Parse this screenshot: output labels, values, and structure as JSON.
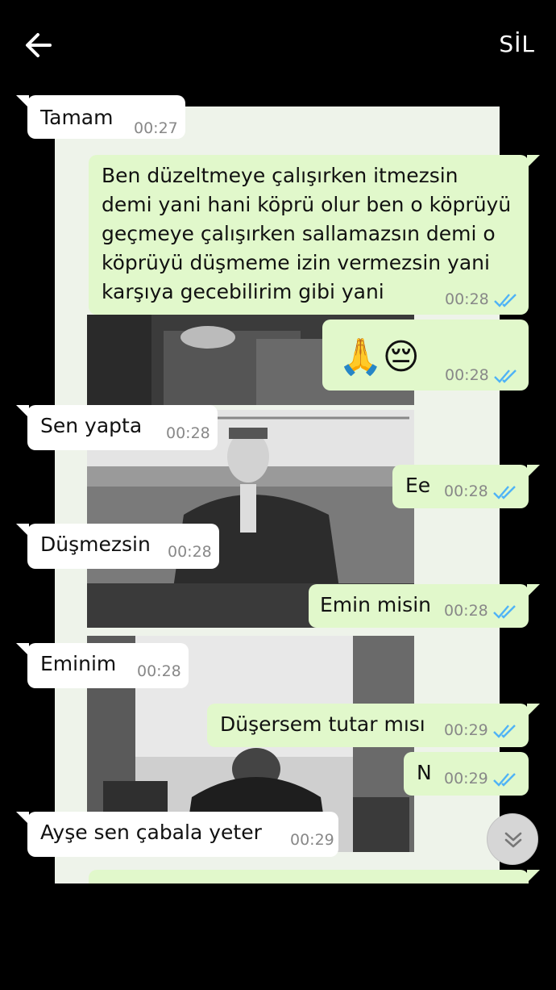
{
  "header": {
    "back_icon": "arrow-left-icon",
    "delete_label": "SİL"
  },
  "messages": [
    {
      "dir": "in",
      "text": "Tamam",
      "time": "00:27"
    },
    {
      "dir": "out",
      "lines": [
        "Ben düzeltmeye çalışırken itmezsin",
        "demi yani hani köprü olur ben o köprüyü",
        "geçmeye çalışırken sallamazsın demi o",
        "köprüyü düşmeme izin vermezsin yani",
        "karşıya gecebilirim gibi yani"
      ],
      "time": "00:28"
    },
    {
      "dir": "out",
      "text": "🙏😔",
      "time": "00:28"
    },
    {
      "dir": "in",
      "text": "Sen yapta",
      "time": "00:28"
    },
    {
      "dir": "out",
      "text": "Ee",
      "time": "00:28"
    },
    {
      "dir": "in",
      "text": "Düşmezsin",
      "time": "00:28"
    },
    {
      "dir": "out",
      "text": "Emin misin",
      "time": "00:28"
    },
    {
      "dir": "in",
      "text": "Eminim",
      "time": "00:28"
    },
    {
      "dir": "out",
      "text": "Düşersem tutar mısı",
      "time": "00:29"
    },
    {
      "dir": "out",
      "text": "N",
      "time": "00:29"
    },
    {
      "dir": "in",
      "text": "Ayşe sen çabala yeter",
      "time": "00:29"
    }
  ],
  "colors": {
    "incoming": "#ffffff",
    "outgoing": "#e1f8cb",
    "read_ticks": "#4fb3f6",
    "background": "#000000"
  },
  "scroll_button_icon": "double-chevron-down-icon"
}
